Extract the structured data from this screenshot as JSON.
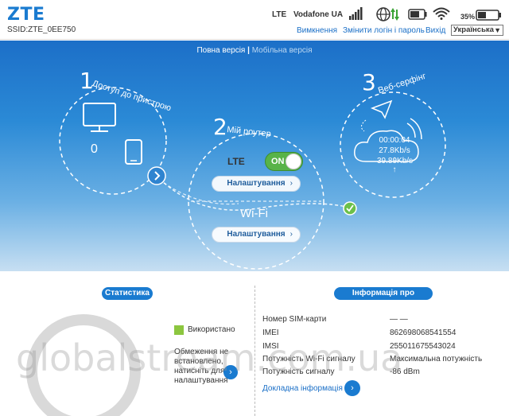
{
  "header": {
    "logo": "ZTE",
    "ssid": "SSID:ZTE_0EE750",
    "network_type": "LTE",
    "operator": "Vodafone UA",
    "battery_percent": "35%",
    "links": {
      "logout": "Вимкнення",
      "change_credentials": "Змінити логін і пароль",
      "exit": "Вихід"
    },
    "language": "Українська"
  },
  "hero": {
    "version_full": "Повна версія",
    "version_separator": "|",
    "version_mobile": "Мобільна версія",
    "steps": [
      {
        "number": "1",
        "label": "Доступ до пристрою"
      },
      {
        "number": "2",
        "label": "Мій роутер"
      },
      {
        "number": "3",
        "label": "Веб-серфінг"
      }
    ],
    "connected_devices": "0",
    "router": {
      "lte_label": "LTE",
      "toggle_state": "ON",
      "settings_label": "Налаштування",
      "wifi_label": "Wi-Fi"
    },
    "stats": {
      "time": "00:00:04",
      "download": "27.8Kb/s ↓",
      "upload": "39.89Kb/s ↑"
    }
  },
  "statistics": {
    "title": "Статистика",
    "used_label": "Використано",
    "limit_note": "Обмеження не встановлено, натисніть для налаштування"
  },
  "device_info": {
    "title": "Інформація про пристрій",
    "rows": [
      {
        "label": "Номер SIM-карти",
        "value": "— —"
      },
      {
        "label": "IMEI",
        "value": "862698068541554"
      },
      {
        "label": "IMSI",
        "value": "255011675543024"
      },
      {
        "label": "Потужність Wi-Fi сигналу",
        "value": "Максимальна потужність"
      },
      {
        "label": "Потужність сигналу",
        "value": "-86 dBm"
      }
    ],
    "details_link": "Докладна інформація"
  },
  "watermark": "globalstream.com.ua",
  "colors": {
    "brand_blue": "#1a7bd0",
    "toggle_green": "#58b348",
    "used_green": "#8cc63f"
  }
}
